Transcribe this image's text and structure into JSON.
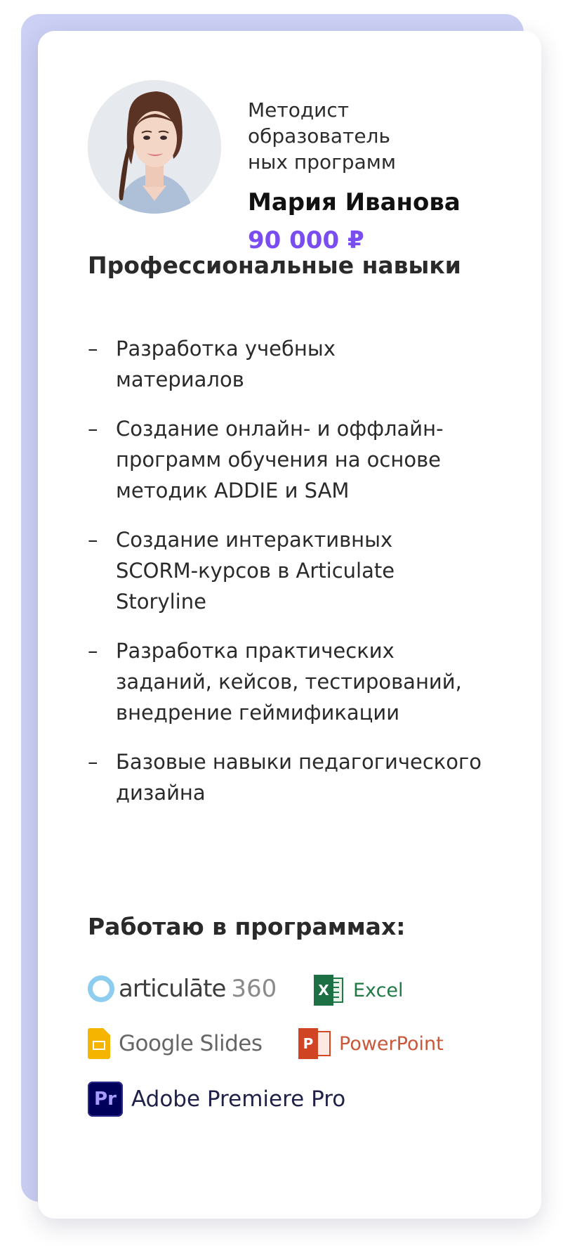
{
  "profile": {
    "role_lines": [
      "Методист",
      "образователь",
      "ных программ"
    ],
    "name": "Мария Иванова",
    "salary": "90 000 ₽",
    "salary_color": "#7a4df0"
  },
  "skills": {
    "title": "Профессиональные навыки",
    "dash": "–",
    "items": [
      [
        "Разработка учебных",
        "материалов"
      ],
      [
        "Создание онлайн- и оффлайн-",
        "программ обучения на основе",
        "методик ADDIE и SAM"
      ],
      [
        "Создание интерактивных",
        "SCORM-курсов в Articulate",
        "Storyline"
      ],
      [
        "Разработка практических",
        "заданий, кейсов, тестирований,",
        "внедрение геймификации"
      ],
      [
        "Базовые навыки педагогического",
        "дизайна"
      ]
    ]
  },
  "programs": {
    "title": "Работаю в программах:",
    "articulate": {
      "name": "articulāte",
      "suffix": "360",
      "icon": "articulate-ring-icon"
    },
    "excel": {
      "name": "Excel",
      "icon_letter": "X",
      "icon": "excel-icon"
    },
    "google_slides": {
      "name": "Google Slides",
      "icon": "google-slides-icon"
    },
    "powerpoint": {
      "name": "PowerPoint",
      "icon_letter": "P",
      "icon": "powerpoint-icon"
    },
    "premiere": {
      "name": "Adobe Premiere Pro",
      "icon_letter": "Pr",
      "icon": "premiere-pro-icon"
    }
  }
}
